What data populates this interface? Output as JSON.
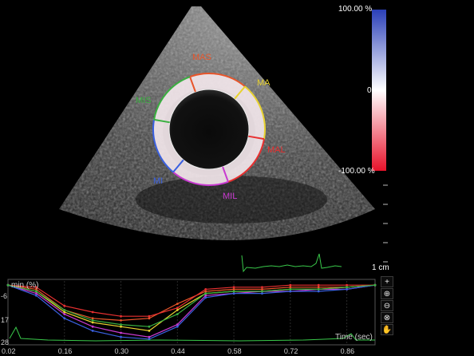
{
  "colorbar": {
    "max_label": "100.00 %",
    "mid_label": "0",
    "min_label": "-100.00 %",
    "colors": {
      "top": "#2a3fb8",
      "mid": "#ffffff",
      "bottom": "#e8122a"
    }
  },
  "scale": {
    "label": "1 cm"
  },
  "segments": [
    {
      "name": "MAS",
      "color": "#e8552a"
    },
    {
      "name": "MA",
      "color": "#e8d230"
    },
    {
      "name": "MAL",
      "color": "#e83030"
    },
    {
      "name": "MIL",
      "color": "#c83ad0"
    },
    {
      "name": "MI",
      "color": "#3a60e0"
    },
    {
      "name": "MIS",
      "color": "#3ab040"
    }
  ],
  "plot": {
    "ylabel": "min (%)",
    "xlabel": "Time (sec)",
    "yticks": [
      "-6",
      "17",
      "28"
    ],
    "xticks": [
      "0.02",
      "0.16",
      "0.30",
      "0.44",
      "0.58",
      "0.72",
      "0.86"
    ],
    "tools": [
      {
        "name": "plus-tool-icon",
        "glyph": "+"
      },
      {
        "name": "zoom-in-icon",
        "glyph": "⊕"
      },
      {
        "name": "zoom-out-icon",
        "glyph": "⊖"
      },
      {
        "name": "zoom-fit-icon",
        "glyph": "⊗"
      },
      {
        "name": "hand-pan-icon",
        "glyph": "✋"
      }
    ]
  },
  "chart_data": {
    "type": "line",
    "ylabel": "min (%)",
    "xlabel": "Time (sec)",
    "x": [
      0.02,
      0.09,
      0.16,
      0.23,
      0.3,
      0.37,
      0.44,
      0.51,
      0.58,
      0.65,
      0.72,
      0.79,
      0.86,
      0.93
    ],
    "series": [
      {
        "color": "#e8552a",
        "values": [
          0,
          -2,
          -12,
          -16,
          -17,
          -16,
          -9,
          -3,
          -2,
          -2,
          -1,
          -1,
          -1,
          0
        ]
      },
      {
        "color": "#e8d230",
        "values": [
          0,
          -3,
          -13,
          -18,
          -20,
          -22,
          -12,
          -4,
          -3,
          -3,
          -2,
          -2,
          -1,
          0
        ]
      },
      {
        "color": "#e83030",
        "values": [
          0,
          -1,
          -10,
          -13,
          -15,
          -15,
          -11,
          -2,
          -1,
          -1,
          0,
          0,
          0,
          0
        ]
      },
      {
        "color": "#c83ad0",
        "values": [
          0,
          -4,
          -14,
          -20,
          -23,
          -25,
          -19,
          -5,
          -4,
          -3,
          -3,
          -2,
          -2,
          0
        ]
      },
      {
        "color": "#3a60e0",
        "values": [
          0,
          -5,
          -16,
          -22,
          -25,
          -26,
          -20,
          -6,
          -4,
          -4,
          -3,
          -3,
          -2,
          0
        ]
      },
      {
        "color": "#3ab040",
        "values": [
          0,
          -3,
          -12,
          -17,
          -19,
          -20,
          -14,
          -4,
          -3,
          -3,
          -2,
          -2,
          -1,
          0
        ]
      }
    ]
  }
}
